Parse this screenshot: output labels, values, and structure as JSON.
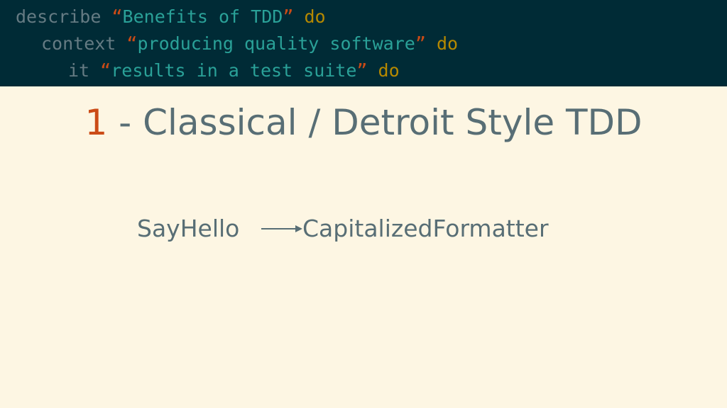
{
  "code": {
    "line1": {
      "keyword": "describe",
      "open_quote": "“",
      "text": "Benefits of TDD",
      "close_quote": "”",
      "do": "do"
    },
    "line2": {
      "keyword": "context",
      "open_quote": "“",
      "text": "producing quality software",
      "close_quote": "”",
      "do": "do"
    },
    "line3": {
      "keyword": "it",
      "open_quote": "“",
      "text": "results in a test suite",
      "close_quote": "”",
      "do": "do"
    }
  },
  "title": {
    "number": "1",
    "text": " - Classical / Detroit Style TDD"
  },
  "diagram": {
    "source": "SayHello",
    "target": "CapitalizedFormatter"
  },
  "colors": {
    "background": "#fdf6e3",
    "code_background": "#002b36",
    "accent": "#cb4b16",
    "string": "#2aa198",
    "keyword_do": "#b58900",
    "text": "#586e75"
  }
}
